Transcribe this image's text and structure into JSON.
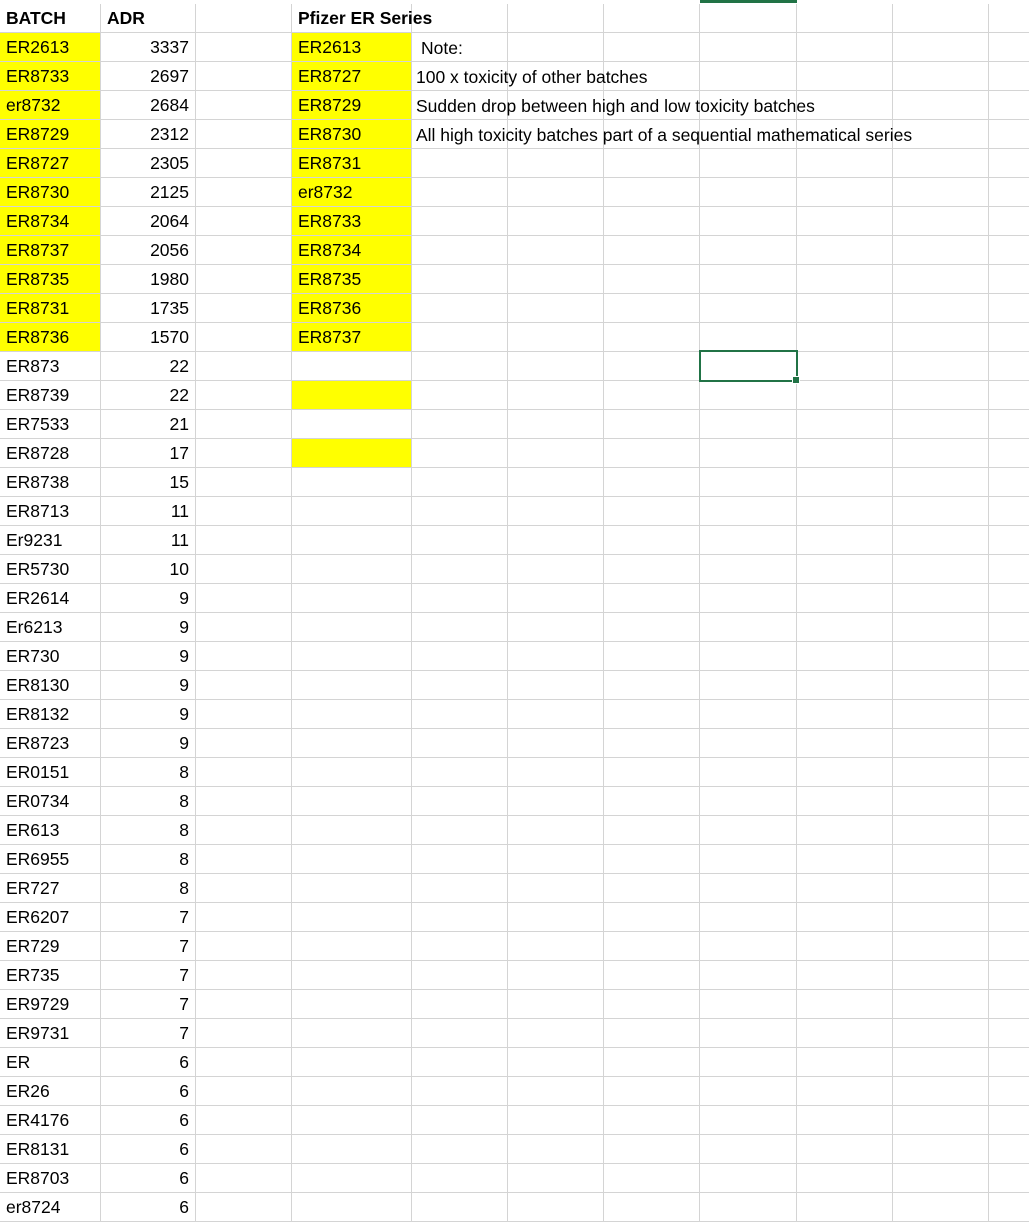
{
  "sheet": {
    "headers": {
      "batch": "BATCH",
      "adr": "ADR",
      "series": "Pfizer ER Series"
    },
    "rows": [
      {
        "batch": "ER2613",
        "adr": "3337",
        "series": "ER2613",
        "hl_batch": true,
        "hl_series": true
      },
      {
        "batch": "ER8733",
        "adr": "2697",
        "series": "ER8727",
        "hl_batch": true,
        "hl_series": true
      },
      {
        "batch": "er8732",
        "adr": "2684",
        "series": "ER8729",
        "hl_batch": true,
        "hl_series": true
      },
      {
        "batch": "ER8729",
        "adr": "2312",
        "series": "ER8730",
        "hl_batch": true,
        "hl_series": true
      },
      {
        "batch": "ER8727",
        "adr": "2305",
        "series": "ER8731",
        "hl_batch": true,
        "hl_series": true
      },
      {
        "batch": "ER8730",
        "adr": "2125",
        "series": "er8732",
        "hl_batch": true,
        "hl_series": true
      },
      {
        "batch": "ER8734",
        "adr": "2064",
        "series": "ER8733",
        "hl_batch": true,
        "hl_series": true
      },
      {
        "batch": "ER8737",
        "adr": "2056",
        "series": "ER8734",
        "hl_batch": true,
        "hl_series": true
      },
      {
        "batch": "ER8735",
        "adr": "1980",
        "series": "ER8735",
        "hl_batch": true,
        "hl_series": true
      },
      {
        "batch": "ER8731",
        "adr": "1735",
        "series": "ER8736",
        "hl_batch": true,
        "hl_series": true
      },
      {
        "batch": "ER8736",
        "adr": "1570",
        "series": "ER8737",
        "hl_batch": true,
        "hl_series": true
      },
      {
        "batch": "ER873",
        "adr": "22",
        "series": "",
        "hl_batch": false,
        "hl_series": false
      },
      {
        "batch": "ER8739",
        "adr": "22",
        "series": "",
        "hl_batch": false,
        "hl_series": true
      },
      {
        "batch": "ER7533",
        "adr": "21",
        "series": "",
        "hl_batch": false,
        "hl_series": false
      },
      {
        "batch": "ER8728",
        "adr": "17",
        "series": "",
        "hl_batch": false,
        "hl_series": true
      },
      {
        "batch": "ER8738",
        "adr": "15",
        "series": "",
        "hl_batch": false,
        "hl_series": false
      },
      {
        "batch": "ER8713",
        "adr": "11",
        "series": "",
        "hl_batch": false,
        "hl_series": false
      },
      {
        "batch": "Er9231",
        "adr": "11",
        "series": "",
        "hl_batch": false,
        "hl_series": false
      },
      {
        "batch": "ER5730",
        "adr": "10",
        "series": "",
        "hl_batch": false,
        "hl_series": false
      },
      {
        "batch": "ER2614",
        "adr": "9",
        "series": "",
        "hl_batch": false,
        "hl_series": false
      },
      {
        "batch": "Er6213",
        "adr": "9",
        "series": "",
        "hl_batch": false,
        "hl_series": false
      },
      {
        "batch": "ER730",
        "adr": "9",
        "series": "",
        "hl_batch": false,
        "hl_series": false
      },
      {
        "batch": "ER8130",
        "adr": "9",
        "series": "",
        "hl_batch": false,
        "hl_series": false
      },
      {
        "batch": "ER8132",
        "adr": "9",
        "series": "",
        "hl_batch": false,
        "hl_series": false
      },
      {
        "batch": "ER8723",
        "adr": "9",
        "series": "",
        "hl_batch": false,
        "hl_series": false
      },
      {
        "batch": "ER0151",
        "adr": "8",
        "series": "",
        "hl_batch": false,
        "hl_series": false
      },
      {
        "batch": "ER0734",
        "adr": "8",
        "series": "",
        "hl_batch": false,
        "hl_series": false
      },
      {
        "batch": "ER613",
        "adr": "8",
        "series": "",
        "hl_batch": false,
        "hl_series": false
      },
      {
        "batch": "ER6955",
        "adr": "8",
        "series": "",
        "hl_batch": false,
        "hl_series": false
      },
      {
        "batch": "ER727",
        "adr": "8",
        "series": "",
        "hl_batch": false,
        "hl_series": false
      },
      {
        "batch": "ER6207",
        "adr": "7",
        "series": "",
        "hl_batch": false,
        "hl_series": false
      },
      {
        "batch": "ER729",
        "adr": "7",
        "series": "",
        "hl_batch": false,
        "hl_series": false
      },
      {
        "batch": "ER735",
        "adr": "7",
        "series": "",
        "hl_batch": false,
        "hl_series": false
      },
      {
        "batch": "ER9729",
        "adr": "7",
        "series": "",
        "hl_batch": false,
        "hl_series": false
      },
      {
        "batch": "ER9731",
        "adr": "7",
        "series": "",
        "hl_batch": false,
        "hl_series": false
      },
      {
        "batch": "ER",
        "adr": "6",
        "series": "",
        "hl_batch": false,
        "hl_series": false
      },
      {
        "batch": "ER26",
        "adr": "6",
        "series": "",
        "hl_batch": false,
        "hl_series": false
      },
      {
        "batch": "ER4176",
        "adr": "6",
        "series": "",
        "hl_batch": false,
        "hl_series": false
      },
      {
        "batch": "ER8131",
        "adr": "6",
        "series": "",
        "hl_batch": false,
        "hl_series": false
      },
      {
        "batch": "ER8703",
        "adr": "6",
        "series": "",
        "hl_batch": false,
        "hl_series": false
      },
      {
        "batch": "er8724",
        "adr": "6",
        "series": "",
        "hl_batch": false,
        "hl_series": false
      }
    ],
    "notes": {
      "title": "Note:",
      "line1": "100 x toxicity of other batches",
      "line2": "Sudden drop between high and low toxicity batches",
      "line3": "All high toxicity batches part of a sequential mathematical series"
    },
    "highlight_color": "#ffff00",
    "selection_color": "#217346",
    "gridline_color": "#d4d4d4"
  }
}
